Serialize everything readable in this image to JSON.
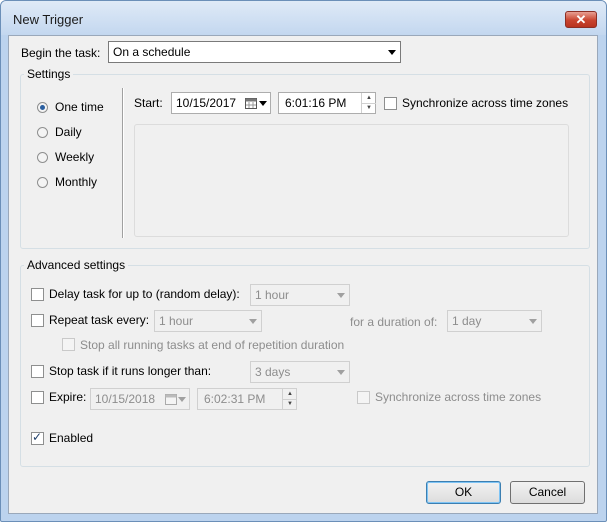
{
  "window": {
    "title": "New Trigger",
    "close": "✕"
  },
  "begin": {
    "label": "Begin the task:",
    "value": "On a schedule"
  },
  "settings": {
    "label": "Settings",
    "schedule_options": [
      {
        "label": "One time",
        "checked": true
      },
      {
        "label": "Daily",
        "checked": false
      },
      {
        "label": "Weekly",
        "checked": false
      },
      {
        "label": "Monthly",
        "checked": false
      }
    ],
    "start_label": "Start:",
    "start_date": "10/15/2017",
    "start_time": "6:01:16 PM",
    "sync_label": "Synchronize across time zones"
  },
  "advanced": {
    "label": "Advanced settings",
    "delay_label": "Delay task for up to (random delay):",
    "delay_value": "1 hour",
    "repeat_label": "Repeat task every:",
    "repeat_value": "1 hour",
    "duration_label": "for a duration of:",
    "duration_value": "1 day",
    "stop_running_label": "Stop all running tasks at end of repetition duration",
    "stop_label": "Stop task if it runs longer than:",
    "stop_value": "3 days",
    "expire_label": "Expire:",
    "expire_date": "10/15/2018",
    "expire_time": "6:02:31 PM",
    "expire_sync_label": "Synchronize across time zones",
    "enabled_label": "Enabled",
    "enabled_checked": true
  },
  "buttons": {
    "ok": "OK",
    "cancel": "Cancel"
  },
  "icons": {
    "calendar": "calendar-icon",
    "spin_up": "▲",
    "spin_down": "▼",
    "check": "✓"
  }
}
